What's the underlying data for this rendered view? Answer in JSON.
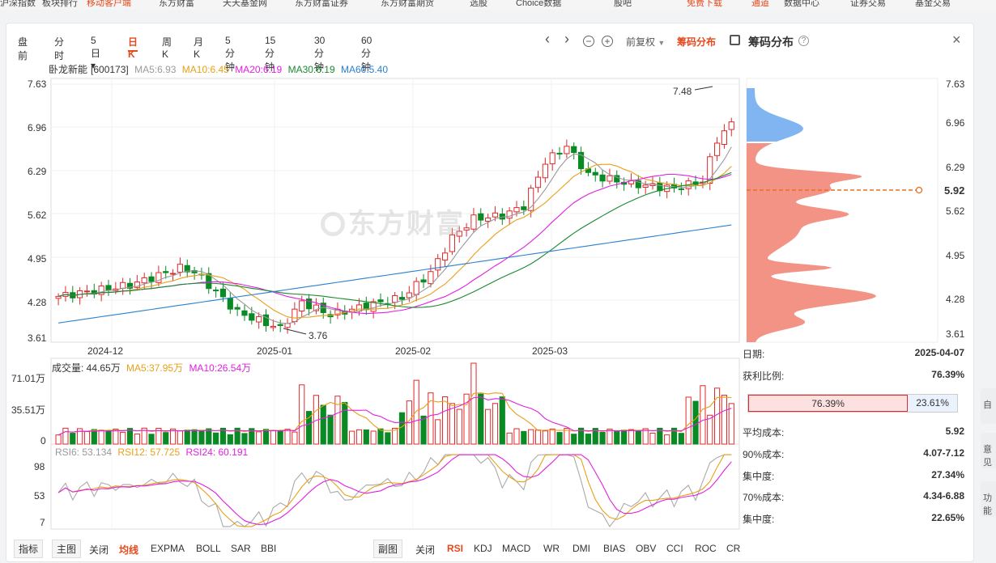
{
  "top_nav": [
    {
      "label": "沪深指数",
      "hot": false
    },
    {
      "label": "板块排行",
      "hot": false
    },
    {
      "label": "移动客户端",
      "hot": true
    },
    {
      "label": "东方财富",
      "hot": false
    },
    {
      "label": "天天基金网",
      "hot": false
    },
    {
      "label": "东方财富证券",
      "hot": false
    },
    {
      "label": "东方财富期货",
      "hot": false
    },
    {
      "label": "选股",
      "hot": false
    },
    {
      "label": "Choice数据",
      "hot": false
    },
    {
      "label": "股吧",
      "hot": false
    },
    {
      "label": "免费下载",
      "hot": true
    },
    {
      "label": "通道",
      "hot": true
    },
    {
      "label": "数据中心",
      "hot": false
    },
    {
      "label": "证券交易",
      "hot": false
    },
    {
      "label": "基金交易",
      "hot": false
    }
  ],
  "periods": [
    "盘前",
    "分时",
    "5日▾",
    "日K",
    "周K",
    "月K",
    "5分钟",
    "15分钟",
    "30分钟",
    "60分钟"
  ],
  "active_period": "日K",
  "toolbar": {
    "fuquan": "前复权",
    "chip_toggle": "筹码分布",
    "chip_title": "筹码分布",
    "help": "?",
    "close": "×",
    "nav_prev": "‹",
    "nav_next": "›",
    "zoom_out": "−",
    "zoom_in": "+"
  },
  "stock": {
    "name": "卧龙新能",
    "code": "[600173]"
  },
  "ma_legend": [
    {
      "text": "MA5:6.93",
      "color": "#9a9a9a"
    },
    {
      "text": "MA10:6.45",
      "color": "#e8a018"
    },
    {
      "text": "MA20:6.19",
      "color": "#e020e0"
    },
    {
      "text": "MA30:6.19",
      "color": "#1a8a30"
    },
    {
      "text": "MA60:5.40",
      "color": "#2a80d0"
    }
  ],
  "price_axis": [
    "7.63",
    "6.96",
    "6.29",
    "5.62",
    "4.95",
    "4.28",
    "3.61"
  ],
  "right_price_axis": [
    "7.63",
    "6.96",
    "6.29",
    "5.62",
    "4.95",
    "4.28",
    "3.61"
  ],
  "date_axis": [
    "2024-12",
    "2025-01",
    "2025-02",
    "2025-03"
  ],
  "annotations": {
    "high": "7.48",
    "low": "3.76"
  },
  "watermark": "东方财富",
  "volume": {
    "label": "成交量: 44.65万",
    "ma5": "MA5:37.95万",
    "ma10": "MA10:26.54万",
    "axis": [
      "71.01万",
      "35.51万",
      "0"
    ]
  },
  "rsi": {
    "rsi6": "RSI6: 53.134",
    "rsi12": "RSI12: 57.725",
    "rsi24": "RSI24: 60.191",
    "axis": [
      "98",
      "53",
      "7"
    ]
  },
  "chip": {
    "avg_cost_marker": "5.92",
    "date_label": "日期:",
    "date": "2025-04-07",
    "profit_ratio_label": "获利比例:",
    "profit_ratio": "76.39%",
    "bar_profit": "76.39%",
    "bar_loss": "23.61%",
    "profit_fraction": 0.7639,
    "avg_cost_label": "平均成本:",
    "avg_cost": "5.92",
    "cost90_label": "90%成本:",
    "cost90": "4.07-7.12",
    "conc90_label": "集中度:",
    "conc90": "27.34%",
    "cost70_label": "70%成本:",
    "cost70": "4.34-6.88",
    "conc70_label": "集中度:",
    "conc70": "22.65%"
  },
  "bottom_left": [
    "指标",
    "主图",
    "关闭",
    "均线",
    "EXPMA",
    "BOLL",
    "SAR",
    "BBI"
  ],
  "bottom_left_active": "均线",
  "bottom_right": [
    "副图",
    "关闭",
    "RSI",
    "KDJ",
    "MACD",
    "WR",
    "DMI",
    "BIAS",
    "OBV",
    "CCI",
    "ROC",
    "CR"
  ],
  "bottom_right_active": "RSI",
  "side_buttons": [
    "自",
    "意见",
    "功能"
  ],
  "colors": {
    "up": "#e0292a",
    "down": "#0a8a24",
    "accent": "#e5491c",
    "chip_profit": "#f08070",
    "chip_loss": "#6aa8f0"
  }
}
